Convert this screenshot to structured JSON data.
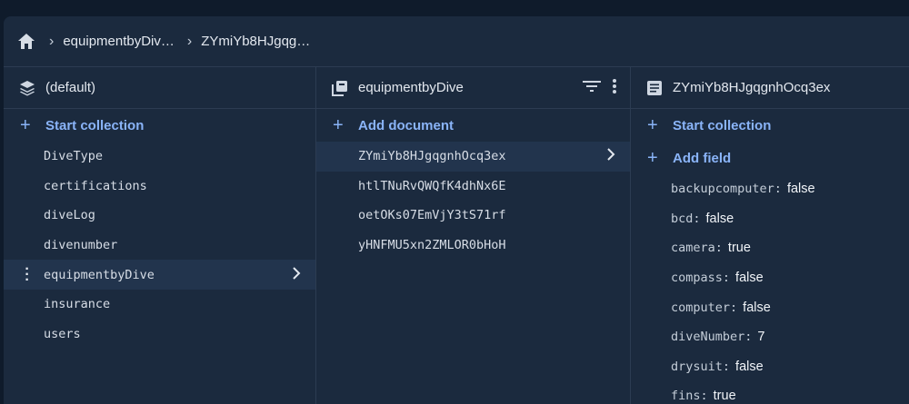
{
  "breadcrumb": {
    "home_icon": "home-icon",
    "items": [
      "equipmentbyDiv…",
      "ZYmiYb8HJgqg…"
    ]
  },
  "col1": {
    "title": "(default)",
    "icon": "stack-icon",
    "action": "Start collection",
    "items": [
      "DiveType",
      "certifications",
      "diveLog",
      "divenumber",
      "equipmentbyDive",
      "insurance",
      "users"
    ],
    "selected_index": 4
  },
  "col2": {
    "title": "equipmentbyDive",
    "icon": "collection-icon",
    "action": "Add document",
    "docs": [
      "ZYmiYb8HJgqgnhOcq3ex",
      "htlTNuRvQWQfK4dhNx6E",
      "oetOKs07EmVjY3tS71rf",
      "yHNFMU5xn2ZMLOR0bHoH"
    ],
    "selected_index": 0
  },
  "col3": {
    "title": "ZYmiYb8HJgqgnhOcq3ex",
    "icon": "document-icon",
    "action1": "Start collection",
    "action2": "Add field",
    "fields": [
      {
        "key": "backupcomputer",
        "value": "false"
      },
      {
        "key": "bcd",
        "value": "false"
      },
      {
        "key": "camera",
        "value": "true"
      },
      {
        "key": "compass",
        "value": "false"
      },
      {
        "key": "computer",
        "value": "false"
      },
      {
        "key": "diveNumber",
        "value": "7"
      },
      {
        "key": "drysuit",
        "value": "false"
      },
      {
        "key": "fins",
        "value": "true"
      }
    ]
  },
  "colors": {
    "accent": "#8ab4f8",
    "panel": "#1b2a3e",
    "selected": "#22344d",
    "background": "#0f1b2b"
  }
}
